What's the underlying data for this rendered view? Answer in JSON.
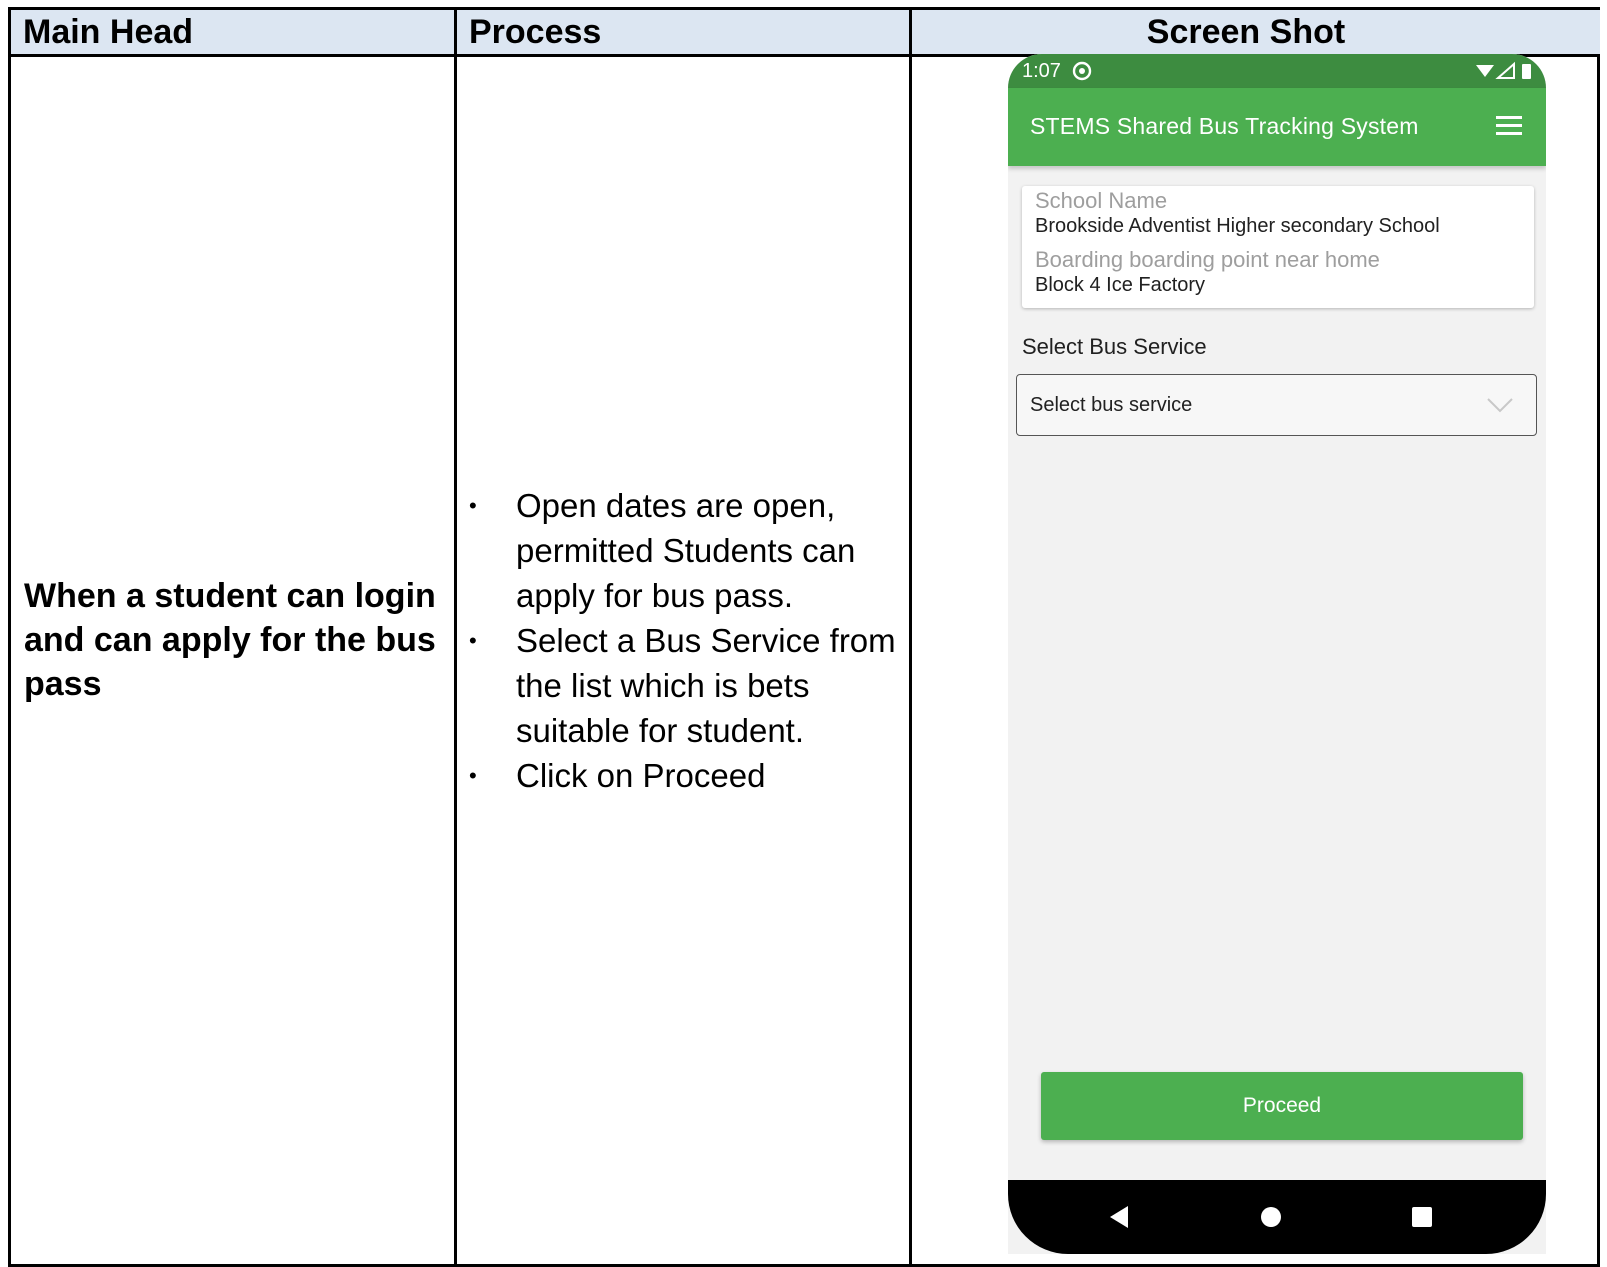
{
  "table": {
    "headers": {
      "main_head": "Main Head",
      "process": "Process",
      "screen_shot": "Screen Shot"
    },
    "main_head_text": "When a student can login and can apply for the bus pass",
    "process_items": [
      "Open dates are open, permitted Students can apply for bus pass.",
      "Select a Bus Service from the list which is bets suitable for student.",
      "Click on Proceed"
    ],
    "bullet_char": "•"
  },
  "phone": {
    "status_bar": {
      "time": "1:07",
      "icons": [
        "app-notification-icon",
        "wifi-icon",
        "cell-signal-icon",
        "battery-icon"
      ]
    },
    "app_bar": {
      "title": "STEMS Shared Bus Tracking System",
      "menu_icon": "menu-icon"
    },
    "info_card": {
      "school_label": "School Name",
      "school_value": "Brookside Adventist Higher secondary School",
      "boarding_label": "Boarding boarding point near home",
      "boarding_value": "Block 4 Ice Factory"
    },
    "bus_service": {
      "label": "Select Bus Service",
      "selected_value": "Select bus service"
    },
    "proceed_label": "Proceed",
    "nav": [
      "back-icon",
      "home-icon",
      "recents-icon"
    ]
  },
  "colors": {
    "header_fill": "#dce6f2",
    "app_green": "#4caf50",
    "status_green": "#3d8c40",
    "screen_background": "#f2f2f2"
  }
}
